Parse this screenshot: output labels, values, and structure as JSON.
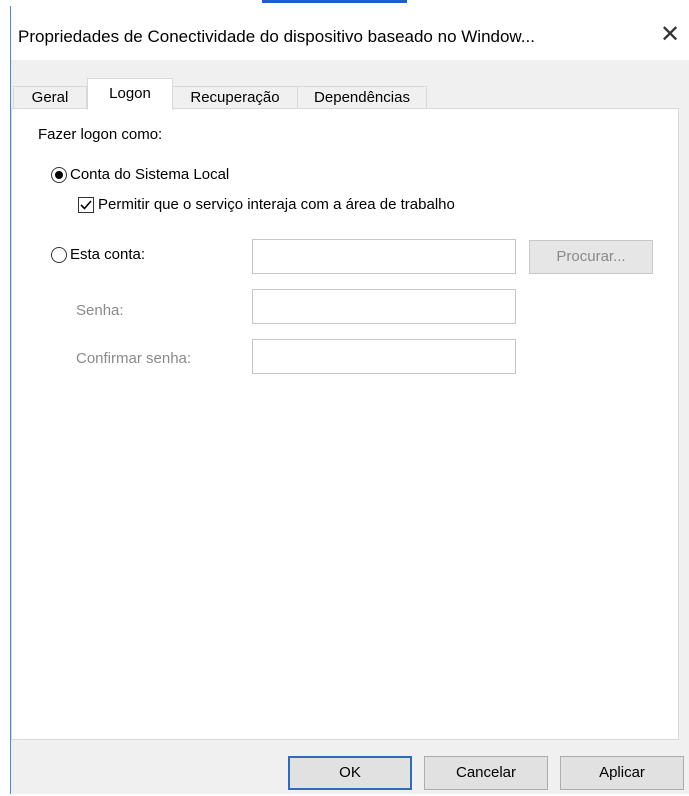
{
  "window": {
    "title": "Propriedades de Conectividade do dispositivo baseado no Window...",
    "close_glyph": "✕"
  },
  "tabs": [
    {
      "label": "Geral"
    },
    {
      "label": "Logon"
    },
    {
      "label": "Recuperação"
    },
    {
      "label": "Dependências"
    }
  ],
  "logon": {
    "section_label": "Fazer logon como:",
    "local_system_label": "Conta do Sistema Local",
    "local_system_selected": true,
    "allow_desktop_label": "Permitir que o serviço interaja com a área de trabalho",
    "allow_desktop_checked": true,
    "this_account_label": "Esta conta:",
    "this_account_value": "",
    "browse_label": "Procurar...",
    "password_label": "Senha:",
    "password_value": "",
    "confirm_label": "Confirmar senha:",
    "confirm_value": ""
  },
  "footer": {
    "ok_label": "OK",
    "cancel_label": "Cancelar",
    "apply_label": "Aplicar"
  },
  "colors": {
    "accent": "#3c8fd6",
    "default_button_border": "#2c6bc0"
  }
}
